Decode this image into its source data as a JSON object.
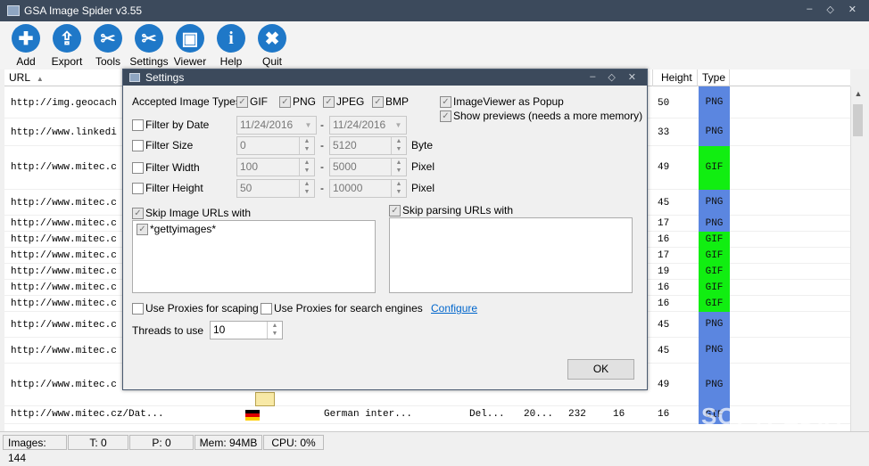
{
  "window": {
    "title": "GSA Image Spider v3.55"
  },
  "toolbar": [
    {
      "label": "Add",
      "icon": "add-icon",
      "glyph": "✚"
    },
    {
      "label": "Export",
      "icon": "export-icon",
      "glyph": "⇪"
    },
    {
      "label": "Tools",
      "icon": "tools-icon",
      "glyph": "✂"
    },
    {
      "label": "Settings",
      "icon": "settings-icon",
      "glyph": "✂"
    },
    {
      "label": "Viewer",
      "icon": "viewer-icon",
      "glyph": "▣"
    },
    {
      "label": "Help",
      "icon": "help-icon",
      "glyph": "i"
    },
    {
      "label": "Quit",
      "icon": "quit-icon",
      "glyph": "✖"
    }
  ],
  "grid": {
    "headers": {
      "url": "URL",
      "sort_glyph": "▲",
      "height": "Height",
      "type": "Type"
    },
    "rows": [
      {
        "url": "http://img.geocach",
        "height": "50",
        "type": "PNG"
      },
      {
        "url": "http://www.linkedi",
        "height": "33",
        "type": "PNG"
      },
      {
        "url": "http://www.mitec.c",
        "height": "49",
        "type": "GIF"
      },
      {
        "url": "http://www.mitec.c",
        "height": "45",
        "type": "PNG"
      },
      {
        "url": "http://www.mitec.c",
        "height": "17",
        "type": "PNG"
      },
      {
        "url": "http://www.mitec.c",
        "height": "16",
        "type": "GIF"
      },
      {
        "url": "http://www.mitec.c",
        "height": "17",
        "type": "GIF"
      },
      {
        "url": "http://www.mitec.c",
        "height": "19",
        "type": "GIF"
      },
      {
        "url": "http://www.mitec.c",
        "height": "16",
        "type": "GIF"
      },
      {
        "url": "http://www.mitec.c",
        "height": "16",
        "type": "GIF"
      },
      {
        "url": "http://www.mitec.c",
        "height": "45",
        "type": "PNG"
      },
      {
        "url": "http://www.mitec.c",
        "height": "45",
        "type": "PNG"
      },
      {
        "url": "http://www.mitec.c",
        "height": "49",
        "type": "PNG"
      },
      {
        "url": "http://www.mitec.cz/Dat...",
        "height": "16",
        "type": "GIF",
        "col_desc": "German inter...",
        "col_a": "Del...",
        "col_b": "20...",
        "col_c": "232",
        "col_d": "16"
      }
    ]
  },
  "status": {
    "images": "Images: 144",
    "threads": "T: 0",
    "parsing": "P: 0",
    "memory": "Mem: 94MB",
    "cpu": "CPU: 0%"
  },
  "watermark": "SOFTPEDIA",
  "colors": {
    "png": "#5b86e0",
    "gif": "#11ee11"
  },
  "settings": {
    "title": "Settings",
    "accepted_types_label": "Accepted Image Types",
    "types": [
      "GIF",
      "PNG",
      "JPEG",
      "BMP"
    ],
    "viewer_popup": "ImageViewer as Popup",
    "show_previews": "Show previews (needs a more memory)",
    "filter_date": {
      "label": "Filter by Date",
      "from": "11/24/2016",
      "to": "11/24/2016"
    },
    "filter_size": {
      "label": "Filter Size",
      "from": "0",
      "to": "5120",
      "unit": "Byte"
    },
    "filter_width": {
      "label": "Filter Width",
      "from": "100",
      "to": "5000",
      "unit": "Pixel"
    },
    "filter_height": {
      "label": "Filter Height",
      "from": "50",
      "to": "10000",
      "unit": "Pixel"
    },
    "dash": "-",
    "skip_image_urls": {
      "label": "Skip Image URLs with",
      "items": [
        "*gettyimages*"
      ]
    },
    "skip_parsing_urls": {
      "label": "Skip parsing URLs with"
    },
    "use_proxies_scraping": "Use Proxies for scaping",
    "use_proxies_search": "Use Proxies for search engines",
    "configure": "Configure",
    "threads_label": "Threads to use",
    "threads_value": "10",
    "ok": "OK"
  }
}
